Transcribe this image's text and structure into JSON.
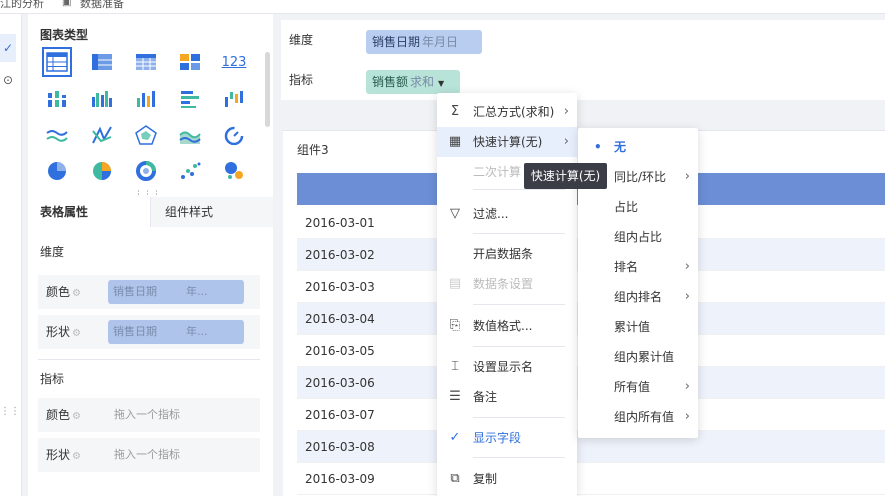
{
  "topbar": {
    "left_text": "江的分析",
    "data_prep_label": "数据准备"
  },
  "panel": {
    "chart_types_title": "图表类型",
    "tabs": {
      "table_props": "表格属性",
      "widget_style": "组件样式"
    },
    "dimension_section": "维度",
    "measure_section": "指标",
    "dim_color_label": "颜色",
    "dim_shape_label": "形状",
    "dim_chip_field": "销售日期",
    "dim_chip_sub": "年...",
    "mea_color_label": "颜色",
    "mea_shape_label": "形状",
    "drop_hint": "拖入一个指标",
    "chart_icon_123": "123"
  },
  "fields": {
    "dimension_label": "维度",
    "measure_label": "指标",
    "dimension_chip": {
      "name": "销售日期",
      "sub": "年月日"
    },
    "measure_chip": {
      "name": "销售额",
      "sub": "求和"
    }
  },
  "widget": {
    "title": "组件3",
    "rows": [
      "2016-03-01",
      "2016-03-02",
      "2016-03-03",
      "2016-03-04",
      "2016-03-05",
      "2016-03-06",
      "2016-03-07",
      "2016-03-08",
      "2016-03-09"
    ]
  },
  "menu": {
    "aggregate": "汇总方式(求和)",
    "quick_calc": "快速计算(无)",
    "secondary_calc": "二次计算",
    "filter": "过滤...",
    "enable_databar": "开启数据条",
    "databar_settings": "数据条设置",
    "number_format": "数值格式...",
    "set_display_name": "设置显示名",
    "remark": "备注",
    "show_field": "显示字段",
    "copy": "复制"
  },
  "tooltip": "快速计算(无)",
  "submenu": {
    "items": [
      "无",
      "同比/环比",
      "占比",
      "组内占比",
      "排名",
      "组内排名",
      "累计值",
      "组内累计值",
      "所有值",
      "组内所有值"
    ]
  },
  "colors": {
    "accent": "#2f6fde",
    "header_blue": "#6b8ed6",
    "dim_chip": "#b9cdf0",
    "measure_chip": "#b8e3d8"
  }
}
